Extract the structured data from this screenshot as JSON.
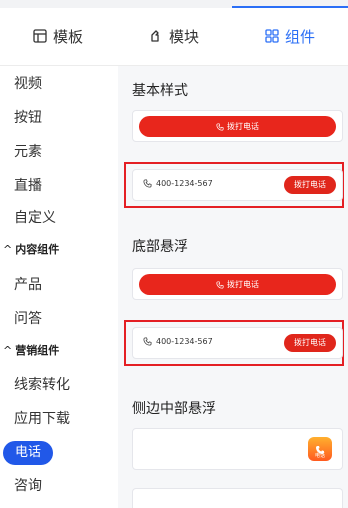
{
  "tabs": [
    {
      "label": "模板",
      "icon": "template-icon",
      "active": false
    },
    {
      "label": "模块",
      "icon": "module-icon",
      "active": false
    },
    {
      "label": "组件",
      "icon": "component-icon",
      "active": true
    }
  ],
  "sidebar": {
    "items": [
      "视频",
      "按钮",
      "元素",
      "直播",
      "自定义"
    ],
    "group1": "内容组件",
    "group1_items": [
      "产品",
      "问答"
    ],
    "group2": "营销组件",
    "group2_items": [
      "线索转化",
      "应用下载"
    ],
    "active_item": "电话",
    "next_item": "咨询"
  },
  "panel": {
    "section1_title": "基本样式",
    "section2_title": "底部悬浮",
    "section3_title": "侧边中部悬浮",
    "call_label": "拨打电话",
    "phone_number": "400-1234-567",
    "call_button": "拨打电话",
    "float_label": "电话"
  },
  "colors": {
    "accent_blue": "#2b6ff6",
    "active_pill": "#2158e8",
    "call_red": "#e8261c",
    "highlight_red": "#e41f24"
  }
}
